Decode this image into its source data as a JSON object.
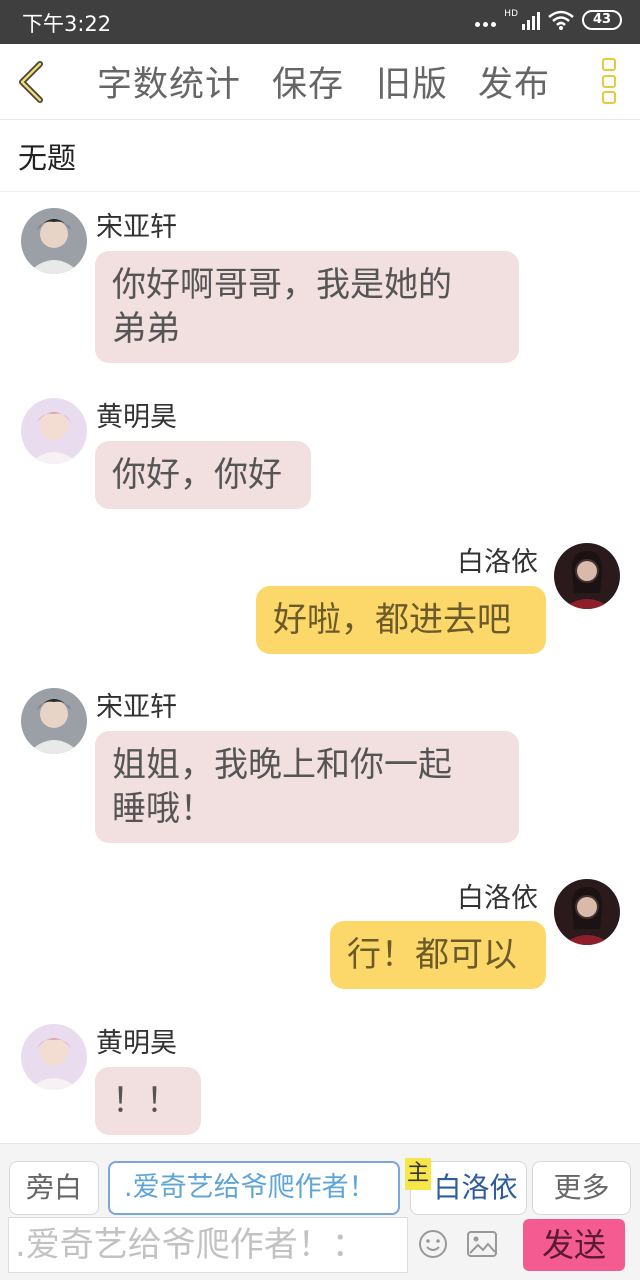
{
  "status_bar": {
    "time": "下午3:22",
    "network_label": "HD",
    "battery": "43"
  },
  "toolbar": {
    "word_count_label": "字数统计",
    "save_label": "保存",
    "old_version_label": "旧版",
    "publish_label": "发布"
  },
  "document": {
    "title": "无题"
  },
  "messages": [
    {
      "sender": "宋亚轩",
      "text_lines": [
        "你好啊哥哥，我是她的",
        "弟弟"
      ],
      "side": "left"
    },
    {
      "sender": "黄明昊",
      "text_lines": [
        "你好，你好"
      ],
      "side": "left"
    },
    {
      "sender": "白洛依",
      "text_lines": [
        "好啦，都进去吧"
      ],
      "side": "right"
    },
    {
      "sender": "宋亚轩",
      "text_lines": [
        "姐姐，我晚上和你一起",
        "睡哦！"
      ],
      "side": "left"
    },
    {
      "sender": "白洛依",
      "text_lines": [
        "行！都可以"
      ],
      "side": "right"
    },
    {
      "sender": "黄明昊",
      "text_lines": [
        "！！"
      ],
      "side": "left"
    }
  ],
  "composer": {
    "narration_label": "旁白",
    "role_input_value": ".爱奇艺给爷爬作者！",
    "main_tag": "主",
    "main_role_label": "白洛依",
    "more_label": "更多",
    "message_placeholder": ".爱奇艺给爷爬作者！：",
    "send_label": "发送"
  },
  "colors": {
    "accent_yellow": "#fcd86a",
    "left_bubble": "#f2dfe0",
    "send_button": "#f45b91",
    "status_bar": "#3f3f3f"
  }
}
